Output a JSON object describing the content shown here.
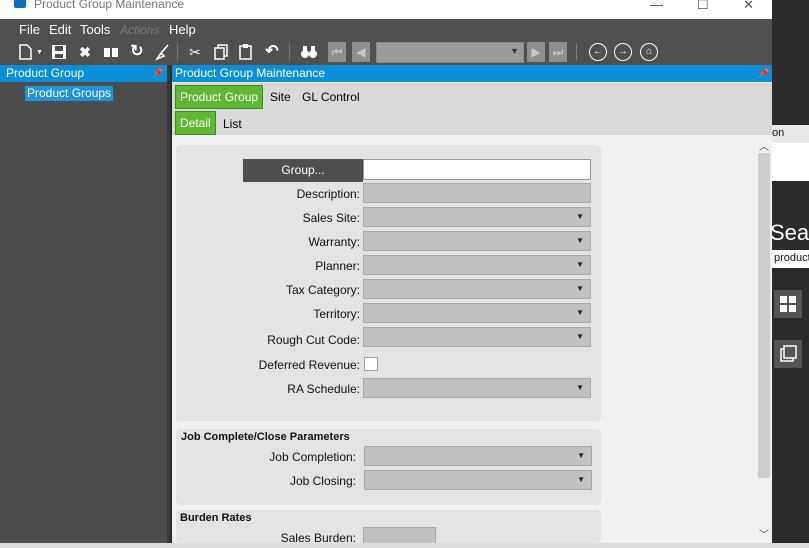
{
  "window": {
    "title": "Product Group Maintenance",
    "controls": {
      "minimize": "—",
      "maximize": "☐",
      "close": "✕"
    }
  },
  "menu": [
    "File",
    "Edit",
    "Tools",
    "Actions",
    "Help"
  ],
  "toolbar": {
    "icons": [
      "new-icon",
      "save-icon",
      "delete-icon",
      "open-book-icon",
      "refresh-icon",
      "clear-icon",
      "cut-icon",
      "copy-icon",
      "paste-icon",
      "undo-icon",
      "binoculars-icon",
      "first-icon",
      "previous-icon",
      "next-icon",
      "last-icon",
      "back-icon",
      "forward-icon",
      "home-icon"
    ],
    "nav_combo_value": ""
  },
  "left_panel": {
    "title": "Product Group",
    "tree_item": "Product Groups"
  },
  "main_panel": {
    "title": "Product Group Maintenance",
    "tabs": [
      "Product Group",
      "Site",
      "GL Control"
    ],
    "subtabs": [
      "Detail",
      "List"
    ]
  },
  "form": {
    "group_button": "Group...",
    "group_value": "",
    "fields": {
      "description": "Description:",
      "sales_site": "Sales Site:",
      "warranty": "Warranty:",
      "planner": "Planner:",
      "tax_category": "Tax Category:",
      "territory": "Territory:",
      "rough_cut_code": "Rough Cut Code:",
      "deferred_revenue": "Deferred Revenue:",
      "ra_schedule": "RA Schedule:"
    },
    "job_section": {
      "title": "Job Complete/Close Parameters",
      "job_completion": "Job Completion:",
      "job_closing": "Job Closing:"
    },
    "burden_section": {
      "title": "Burden Rates",
      "sales_burden": "Sales Burden:"
    }
  },
  "background_window": {
    "tab_fragment": "on",
    "search_fragment": "Sear",
    "search_value": "product"
  },
  "colors": {
    "accent": "#0a8fd8",
    "active_tab": "#5fb832"
  }
}
